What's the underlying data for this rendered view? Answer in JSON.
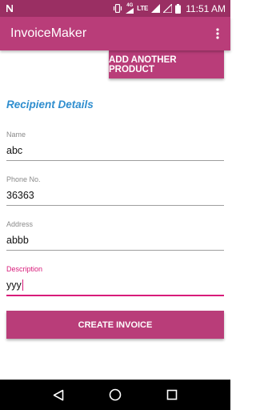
{
  "status_bar": {
    "time": "11:51",
    "ampm": "AM",
    "network": "LTE",
    "network_small": "4G",
    "icons": [
      "notification-n-icon",
      "vibrate-icon",
      "signal-icon",
      "wifi-icon",
      "battery-icon"
    ]
  },
  "app_bar": {
    "title": "InvoiceMaker",
    "overflow_icon": "more-vert-icon"
  },
  "add_product_button": "ADD ANOTHER PRODUCT",
  "section_title": "Recipient Details",
  "fields": [
    {
      "label": "Name",
      "value": "abc"
    },
    {
      "label": "Phone No.",
      "value": "36363"
    },
    {
      "label": "Address",
      "value": "abbb"
    },
    {
      "label": "Description",
      "value": "yyy"
    }
  ],
  "create_button": "CREATE INVOICE",
  "nav_bar": {
    "icons": [
      "back-icon",
      "home-icon",
      "recents-icon"
    ]
  },
  "colors": {
    "status_bar": "#9a2f63",
    "primary": "#b93d79",
    "accent": "#d81b7a",
    "section_title": "#2f8ecf"
  }
}
